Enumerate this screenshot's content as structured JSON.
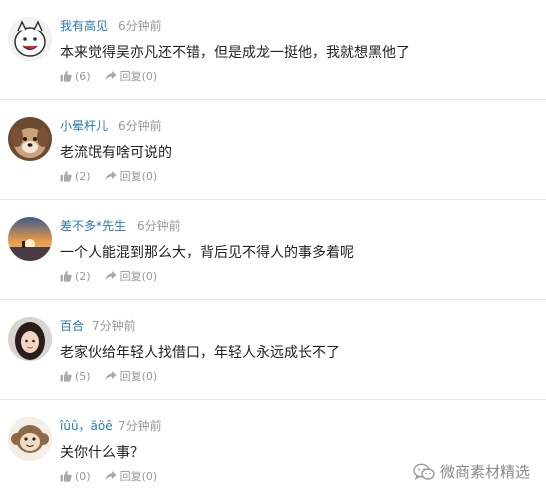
{
  "comments": [
    {
      "author": "我有高见",
      "time": "6分钟前",
      "text": "本来觉得吴亦凡还不错，但是成龙一挺他，我就想黑他了",
      "likes": "(6)",
      "reply_label": "回复",
      "replies": "(0)",
      "avatar_icon": "cartoon-face-avatar"
    },
    {
      "author": "小晕杆儿",
      "time": "6分钟前",
      "text": "老流氓有啥可说的",
      "likes": "(2)",
      "reply_label": "回复",
      "replies": "(0)",
      "avatar_icon": "dog-photo-avatar"
    },
    {
      "author": "差不多*先生",
      "time": "6分钟前",
      "text": "一个人能混到那么大，背后见不得人的事多着呢",
      "likes": "(2)",
      "reply_label": "回复",
      "replies": "(0)",
      "avatar_icon": "sunset-photo-avatar"
    },
    {
      "author": "百合",
      "time": "7分钟前",
      "text": "老家伙给年轻人找借口，年轻人永远成长不了",
      "likes": "(5)",
      "reply_label": "回复",
      "replies": "(0)",
      "avatar_icon": "woman-photo-avatar"
    },
    {
      "author": "îûû，ãöê",
      "time": "7分钟前",
      "text": "关你什么事？",
      "likes": "(0)",
      "reply_label": "回复",
      "replies": "(0)",
      "avatar_icon": "cartoon-monkey-avatar"
    }
  ],
  "watermark": {
    "text": "微商素材精选",
    "icon": "wechat-icon"
  },
  "colors": {
    "author": "#2a7ab7",
    "meta": "#999999",
    "divider": "#e6e6e6"
  }
}
